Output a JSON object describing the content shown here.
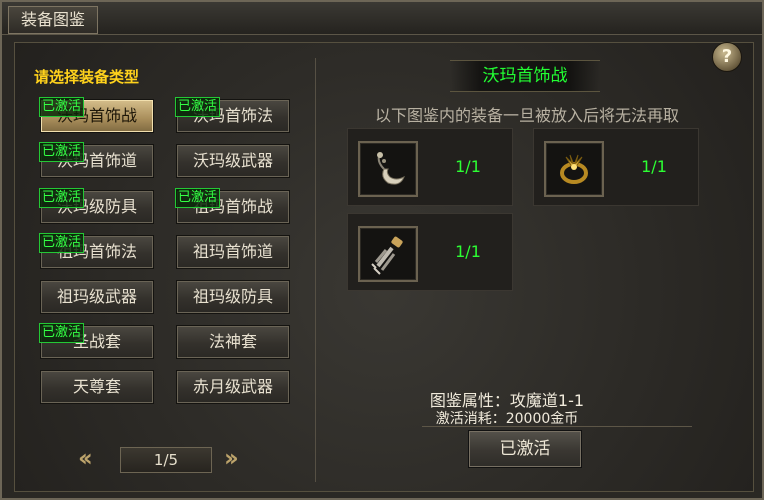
{
  "window": {
    "title": "装备图鉴",
    "help_label": "?"
  },
  "left_panel": {
    "prompt": "请选择装备类型",
    "badge_label": "已激活",
    "categories": [
      {
        "label": "沃玛首饰战",
        "activated": true,
        "selected": true
      },
      {
        "label": "沃玛首饰法",
        "activated": true,
        "selected": false
      },
      {
        "label": "沃玛首饰道",
        "activated": true,
        "selected": false
      },
      {
        "label": "沃玛级武器",
        "activated": false,
        "selected": false
      },
      {
        "label": "沃玛级防具",
        "activated": true,
        "selected": false
      },
      {
        "label": "祖玛首饰战",
        "activated": true,
        "selected": false
      },
      {
        "label": "祖玛首饰法",
        "activated": true,
        "selected": false
      },
      {
        "label": "祖玛首饰道",
        "activated": false,
        "selected": false
      },
      {
        "label": "祖玛级武器",
        "activated": false,
        "selected": false
      },
      {
        "label": "祖玛级防具",
        "activated": false,
        "selected": false
      },
      {
        "label": "圣战套",
        "activated": true,
        "selected": false
      },
      {
        "label": "法神套",
        "activated": false,
        "selected": false
      },
      {
        "label": "天尊套",
        "activated": false,
        "selected": false
      },
      {
        "label": "赤月级武器",
        "activated": false,
        "selected": false
      }
    ],
    "pager": {
      "prev_icon": "double-chevron-left-icon",
      "next_icon": "double-chevron-right-icon",
      "page_text": "1/5"
    }
  },
  "right_panel": {
    "set_title": "沃玛首饰战",
    "notice": "以下图鉴内的装备一旦被放入后将无法再取",
    "items": [
      {
        "icon": "necklace-icon",
        "count": "1/1"
      },
      {
        "icon": "ring-icon",
        "count": "1/1"
      },
      {
        "icon": "bracelet-icon",
        "count": "1/1"
      }
    ],
    "attribute_text": "图鉴属性：攻魔道1-1",
    "cost_text": "激活消耗：20000金币",
    "activate_button": "已激活"
  },
  "colors": {
    "badge_green": "#33ff44",
    "title_green": "#22ff33",
    "prompt_yellow": "#ffd21c",
    "selected_gold": "#c9b07a"
  }
}
